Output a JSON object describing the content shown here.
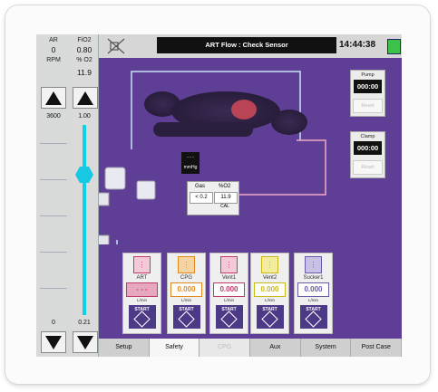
{
  "left": {
    "col1": {
      "label": "AR",
      "value": "0",
      "unit": "RPM",
      "scale_top": "3600",
      "scale_bottom": "0"
    },
    "col2": {
      "label": "FiO2",
      "value": "0.80",
      "unit": "% O2",
      "value2": "11.9",
      "scale_top": "1.00",
      "scale_bottom": "0.21"
    }
  },
  "topbar": {
    "message": "ART Flow : Check Sensor",
    "clock": "14:44:38"
  },
  "right": {
    "pump": {
      "title": "Pump",
      "time": "000:00",
      "reset": "Reset"
    },
    "clamp": {
      "title": "Clamp",
      "time": "000:00",
      "reset": "Reset"
    }
  },
  "gas": {
    "gas_label": "Gas",
    "o2_label": "%O2",
    "gas_value": "< 0.2",
    "o2_value": "11.9",
    "cal": "CAL"
  },
  "monitor": {
    "dots": "- - -",
    "unit": "mmHg"
  },
  "cards": [
    {
      "name": "ART",
      "flow": "- - -",
      "unit": "L/min",
      "start": "START",
      "color": "#c23a6a",
      "icon_bg": "#f2c9d8"
    },
    {
      "name": "CPG",
      "flow": "0.000",
      "unit": "L/min",
      "start": "START",
      "color": "#e08a1e",
      "icon_bg": "#f5d3a3"
    },
    {
      "name": "Vent1",
      "flow": "0.000",
      "unit": "L/min",
      "start": "START",
      "color": "#c23a6a",
      "icon_bg": "#f2c9d8"
    },
    {
      "name": "Vent2",
      "flow": "0.000",
      "unit": "L/min",
      "start": "START",
      "color": "#c8b81a",
      "icon_bg": "#f2ec9e"
    },
    {
      "name": "Sucker1",
      "flow": "0.000",
      "unit": "L/min",
      "start": "START",
      "color": "#6a5aa5",
      "icon_bg": "#c9c0e6"
    }
  ],
  "tabs": [
    {
      "label": "Setup",
      "state": "normal"
    },
    {
      "label": "Safety",
      "state": "active"
    },
    {
      "label": "CPG",
      "state": "disabled"
    },
    {
      "label": "Aux",
      "state": "normal"
    },
    {
      "label": "System",
      "state": "normal"
    },
    {
      "label": "Post Case",
      "state": "normal"
    }
  ],
  "colors": {
    "screen_bg": "#5e3f95",
    "track": "#0bd3ec",
    "battery": "#3cc24a"
  }
}
